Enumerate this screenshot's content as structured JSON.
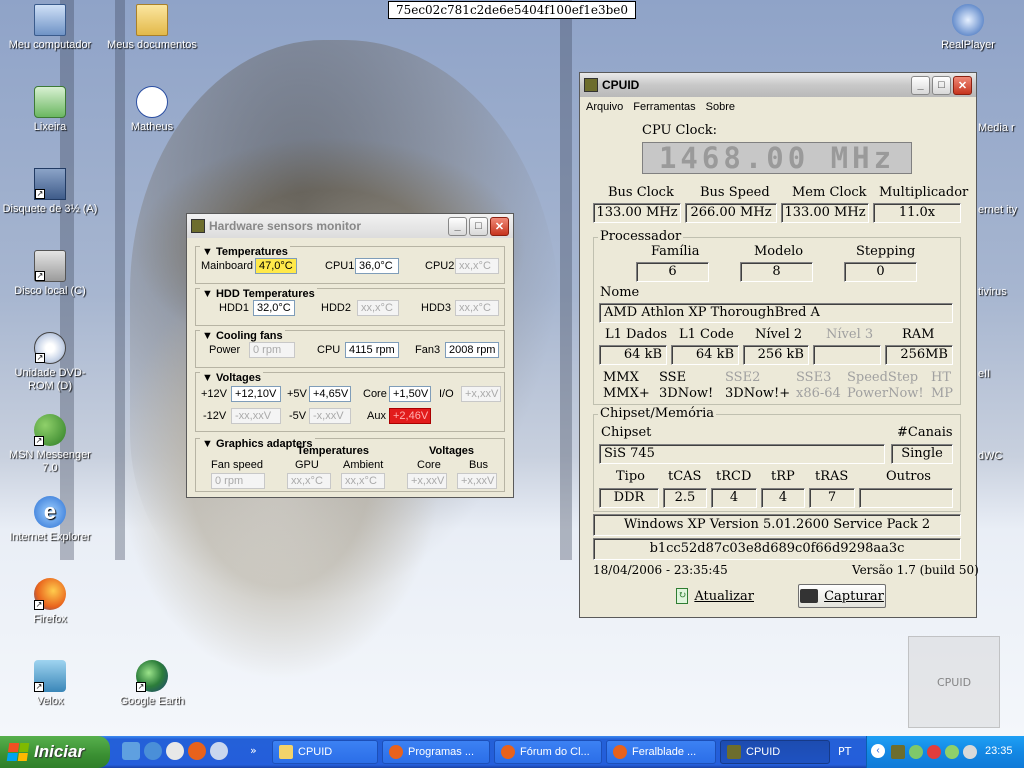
{
  "hash_bar": "75ec02c781c2de6e5404f100ef1e3be0",
  "desktop_icons": [
    {
      "label": "Meu computador"
    },
    {
      "label": "Meus documentos"
    },
    {
      "label": "Lixeira"
    },
    {
      "label": "Matheus"
    },
    {
      "label": "Disquete de 3½ (A)"
    },
    {
      "label": "Disco local (C)"
    },
    {
      "label": "Unidade DVD-ROM (D)"
    },
    {
      "label": "MSN Messenger 7.0"
    },
    {
      "label": "Internet Explorer"
    },
    {
      "label": "Firefox"
    },
    {
      "label": "Velox"
    },
    {
      "label": "Google Earth"
    },
    {
      "label": "RealPlayer"
    },
    {
      "label": "Media r"
    },
    {
      "label": "ernet ity"
    },
    {
      "label": "tivirus"
    },
    {
      "label": "eII"
    },
    {
      "label": "dWC"
    }
  ],
  "hwmon": {
    "title": "Hardware sensors monitor",
    "temperatures": {
      "heading": "Temperatures",
      "mainboard_label": "Mainboard",
      "mainboard": "47,0°C",
      "cpu1_label": "CPU1",
      "cpu1": "36,0°C",
      "cpu2_label": "CPU2",
      "cpu2": "xx,x°C"
    },
    "hdd": {
      "heading": "HDD Temperatures",
      "hdd1_label": "HDD1",
      "hdd1": "32,0°C",
      "hdd2_label": "HDD2",
      "hdd2": "xx,x°C",
      "hdd3_label": "HDD3",
      "hdd3": "xx,x°C"
    },
    "fans": {
      "heading": "Cooling fans",
      "power_label": "Power",
      "power": "0 rpm",
      "cpu_label": "CPU",
      "cpu": "4115 rpm",
      "fan3_label": "Fan3",
      "fan3": "2008 rpm"
    },
    "voltages": {
      "heading": "Voltages",
      "p12_label": "+12V",
      "p12": "+12,10V",
      "p5_label": "+5V",
      "p5": "+4,65V",
      "core_label": "Core",
      "core": "+1,50V",
      "io_label": "I/O",
      "io": "+x,xxV",
      "m12_label": "-12V",
      "m12": "-xx,xxV",
      "m5_label": "-5V",
      "m5": "-x,xxV",
      "aux_label": "Aux",
      "aux": "+2,46V"
    },
    "graphics": {
      "heading": "Graphics adapters",
      "temps_heading": "Temperatures",
      "volts_heading": "Voltages",
      "fan_label": "Fan speed",
      "fan": "0 rpm",
      "gpu_label": "GPU",
      "gpu": "xx,x°C",
      "ambient_label": "Ambient",
      "ambient": "xx,x°C",
      "core_label": "Core",
      "core": "+x,xxV",
      "bus_label": "Bus",
      "bus": "+x,xxV"
    }
  },
  "cpuid": {
    "title": "CPUID",
    "menu": [
      "Arquivo",
      "Ferramentas",
      "Sobre"
    ],
    "cpu_clock_label": "CPU Clock:",
    "cpu_clock": "1468.00 MHz",
    "bus_clock_label": "Bus Clock",
    "bus_clock": "133.00 MHz",
    "bus_speed_label": "Bus Speed",
    "bus_speed": "266.00 MHz",
    "mem_clock_label": "Mem Clock",
    "mem_clock": "133.00 MHz",
    "mult_label": "Multiplicador",
    "mult": "11.0x",
    "proc_heading": "Processador",
    "familia_label": "Família",
    "familia": "6",
    "modelo_label": "Modelo",
    "modelo": "8",
    "stepping_label": "Stepping",
    "stepping": "0",
    "nome_label": "Nome",
    "nome": "AMD Athlon XP ThoroughBred A",
    "l1d_label": "L1 Dados",
    "l1d": "64 kB",
    "l1c_label": "L1 Code",
    "l1c": "64 kB",
    "l2_label": "Nível 2",
    "l2": "256 kB",
    "l3_label": "Nível 3",
    "l3": "",
    "ram_label": "RAM",
    "ram": "256MB",
    "features": [
      "MMX",
      "SSE",
      "SSE2",
      "SSE3",
      "SpeedStep",
      "HT",
      "MMX+",
      "3DNow!",
      "3DNow!+",
      "x86-64",
      "PowerNow!",
      "MP"
    ],
    "chipset_heading": "Chipset/Memória",
    "chipset_label": "Chipset",
    "chipset": "SiS 745",
    "canais_label": "#Canais",
    "canais": "Single",
    "tipo_label": "Tipo",
    "tipo": "DDR",
    "tcas_label": "tCAS",
    "tcas": "2.5",
    "trcd_label": "tRCD",
    "trcd": "4",
    "trp_label": "tRP",
    "trp": "4",
    "tras_label": "tRAS",
    "tras": "7",
    "outros_label": "Outros",
    "outros": "",
    "os": "Windows XP Version 5.01.2600 Service Pack 2",
    "hash": "b1cc52d87c03e8d689c0f66d9298aa3c",
    "datetime": "18/04/2006 - 23:35:45",
    "version": "Versão 1.7 (build 50)",
    "btn_refresh": "Atualizar",
    "btn_capture": "Capturar"
  },
  "watermark": "CPUID",
  "taskbar": {
    "start": "Iniciar",
    "tasks": [
      "CPUID",
      "Programas ...",
      "Fórum do Cl...",
      "Feralblade ...",
      "CPUID"
    ],
    "lang": "PT",
    "clock": "23:35"
  }
}
